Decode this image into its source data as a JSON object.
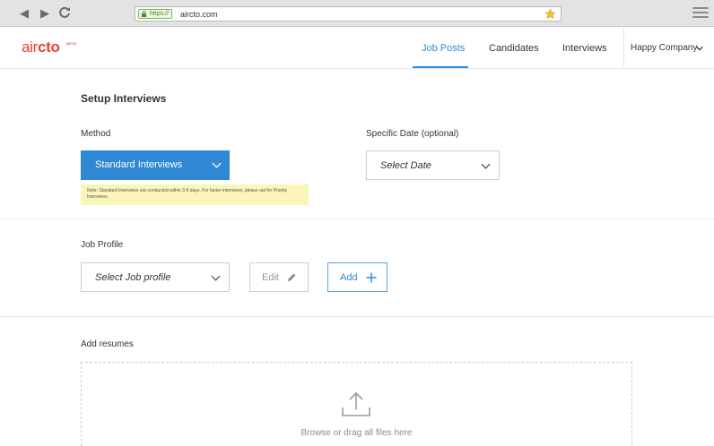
{
  "browser": {
    "https_label": "https://",
    "url": "aircto.com"
  },
  "app": {
    "logo_light": "air",
    "logo_bold": "cto",
    "logo_badge": "(BETA)",
    "nav": [
      {
        "label": "Job Posts",
        "active": true
      },
      {
        "label": "Candidates",
        "active": false
      },
      {
        "label": "Interviews",
        "active": false
      }
    ],
    "company": "Happy Company"
  },
  "setup": {
    "title": "Setup Interviews",
    "method_label": "Method",
    "method_value": "Standard Interviews",
    "note": "Note: Standard Interviews are conducted within 3-5 days. For faster interviews, please opt for Priority Interviews.",
    "date_label": "Specific Date (optional)",
    "date_placeholder": "Select Date"
  },
  "job_profile": {
    "label": "Job Profile",
    "placeholder": "Select Job profile",
    "edit_label": "Edit",
    "add_label": "Add"
  },
  "resumes": {
    "label": "Add resumes",
    "drop_text": "Browse or drag all files here"
  },
  "colors": {
    "accent": "#2f88d4",
    "brand": "#e8433b",
    "note_bg": "#fbf6b8"
  }
}
